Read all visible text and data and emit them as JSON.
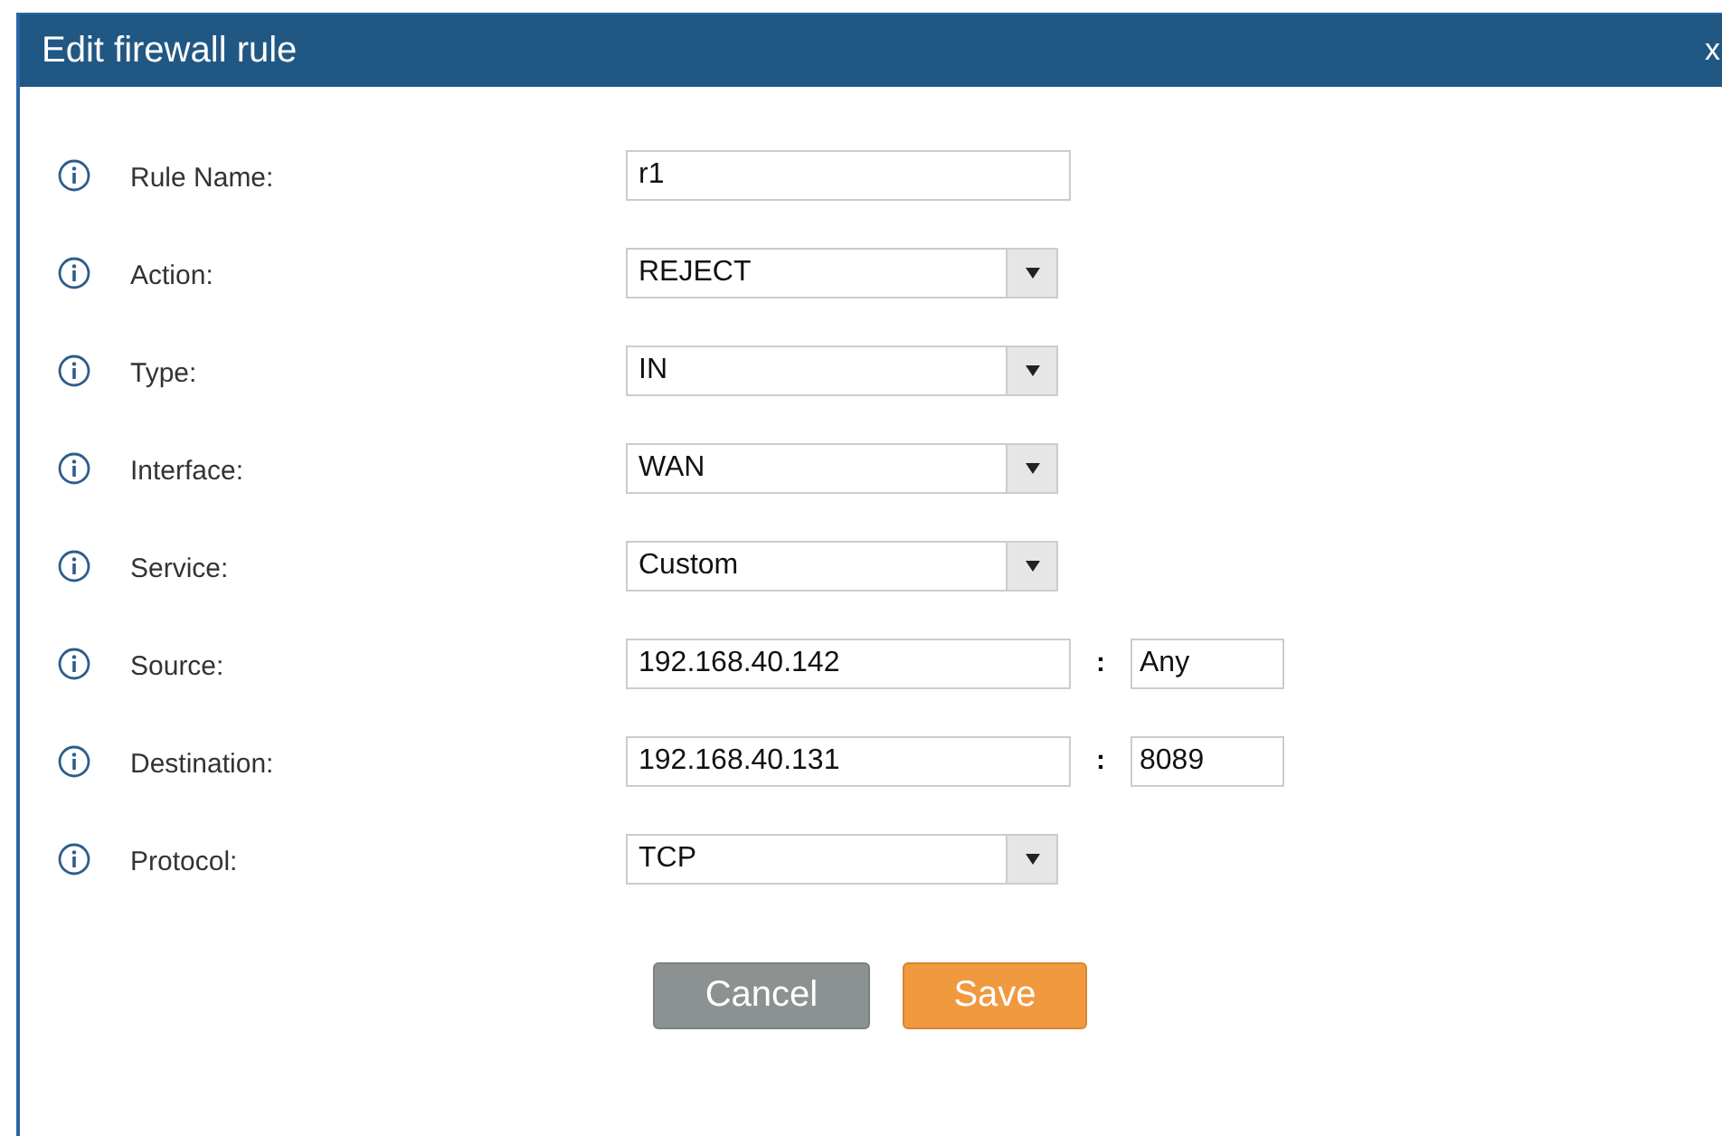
{
  "dialog": {
    "title": "Edit firewall rule",
    "close": "x"
  },
  "fields": [
    {
      "kind": "text",
      "label": "Rule Name:",
      "value": "r1"
    },
    {
      "kind": "select",
      "label": "Action:",
      "value": "REJECT"
    },
    {
      "kind": "select",
      "label": "Type:",
      "value": "IN"
    },
    {
      "kind": "select",
      "label": "Interface:",
      "value": "WAN"
    },
    {
      "kind": "select",
      "label": "Service:",
      "value": "Custom"
    },
    {
      "kind": "address",
      "label": "Source:",
      "value": "192.168.40.142",
      "separator": ":",
      "port": "Any"
    },
    {
      "kind": "address",
      "label": "Destination:",
      "value": "192.168.40.131",
      "separator": ":",
      "port": "8089"
    },
    {
      "kind": "select",
      "label": "Protocol:",
      "value": "TCP"
    }
  ],
  "buttons": [
    {
      "kind": "cancel",
      "label": "Cancel"
    },
    {
      "kind": "save",
      "label": "Save"
    }
  ]
}
